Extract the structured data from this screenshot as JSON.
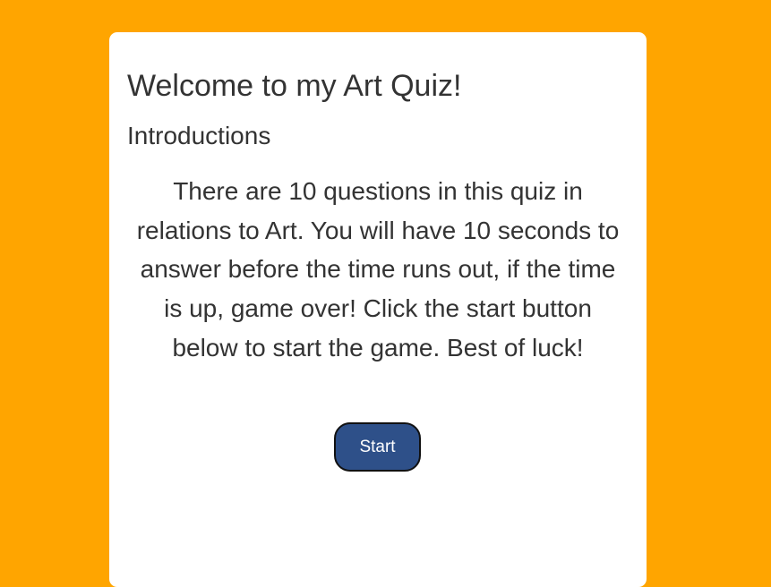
{
  "quiz": {
    "title": "Welcome to my Art Quiz!",
    "subtitle": "Introductions",
    "intro": "There are 10 questions in this quiz in relations to Art. You will have 10 seconds to answer before the time runs out, if the time is up, game over! Click the start button below to start the game. Best of luck!",
    "start_label": "Start"
  },
  "colors": {
    "background": "#ffa500",
    "button": "#2e5089"
  }
}
